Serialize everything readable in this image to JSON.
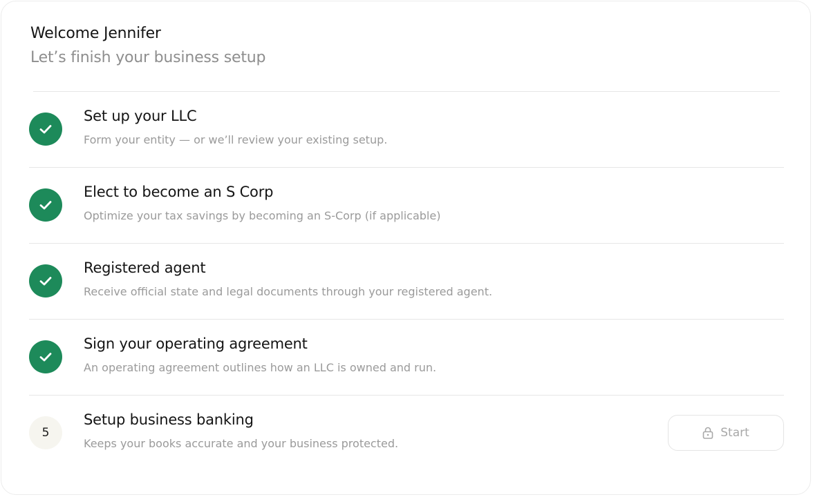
{
  "header": {
    "welcome": "Welcome Jennifer",
    "subtitle": "Let’s finish your business setup"
  },
  "steps": [
    {
      "status": "complete",
      "title": "Set up your LLC",
      "description": "Form your entity — or we’ll review your existing setup."
    },
    {
      "status": "complete",
      "title": "Elect to become an S Corp",
      "description": "Optimize your tax savings by becoming an S-Corp (if applicable)"
    },
    {
      "status": "complete",
      "title": "Registered agent",
      "description": "Receive official state and legal documents through your registered agent."
    },
    {
      "status": "complete",
      "title": "Sign your operating agreement",
      "description": "An operating agreement outlines how an LLC is owned and run."
    },
    {
      "status": "locked",
      "number": "5",
      "title": "Setup business banking",
      "description": "Keeps your books accurate and your business protected.",
      "action_label": "Start",
      "action_icon": "lock-icon"
    }
  ],
  "colors": {
    "complete": "#1d8a5a",
    "pending_bg": "#f6f5ef",
    "muted_text": "#9a9a9a"
  }
}
